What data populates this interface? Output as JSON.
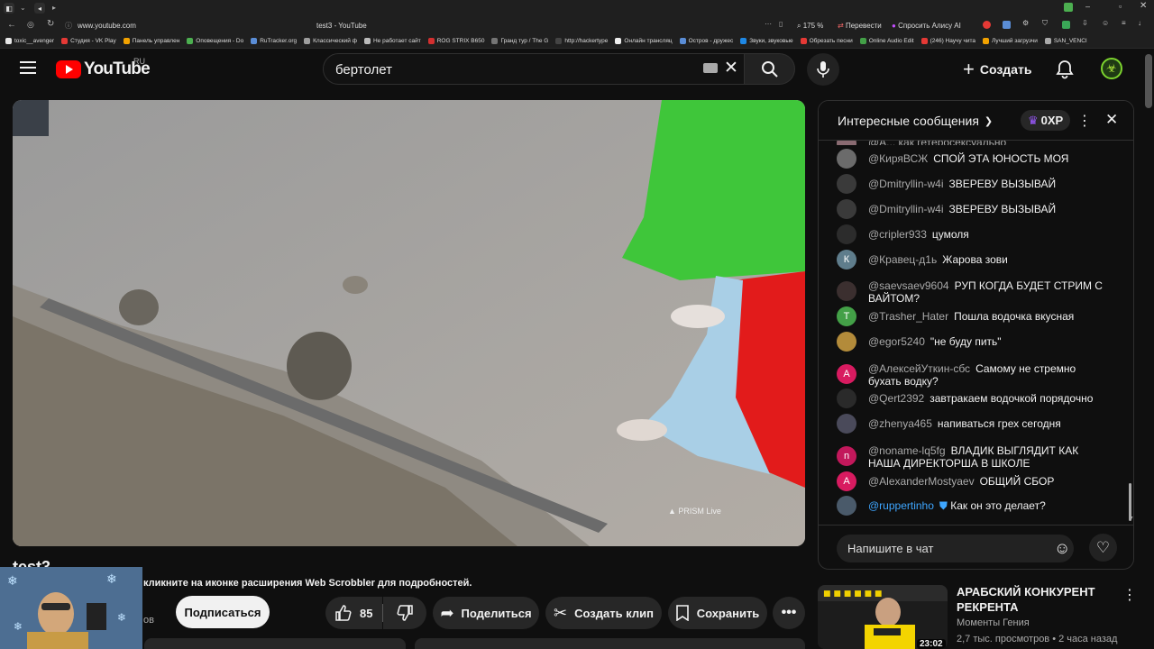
{
  "browser": {
    "url": "www.youtube.com",
    "tab_title": "test3 - YouTube",
    "zoom": "175 %",
    "translate": "Перевести",
    "ask_alice": "Спросить Алису AI",
    "bookmarks": [
      "toxic__avenger",
      "Студия - VK Play",
      "Панель управлен",
      "Оповещения - Do",
      "RuTracker.org",
      "Классический ф",
      "Не работает сайт",
      "ROG STRIX B650",
      "Гранд тур / The G",
      "http://hackertype",
      "Онлайн трансляц",
      "Остров - дружес",
      "Звуки, звуковые",
      "Обрезать песни",
      "Online Audio Edit",
      "(246) Научу чита",
      "Лучший загрузчи",
      "SAN_VENCI"
    ]
  },
  "header": {
    "logo_text": "YouTube",
    "region": "RU",
    "search_value": "бертолет",
    "create_label": "Создать"
  },
  "video": {
    "watermark": "PRISM Live"
  },
  "below": {
    "title": "test3",
    "notice": "кликните на иконке расширения Web Scrobbler для подробностей.",
    "channel_fragment": "ов",
    "subscribe": "Подписаться",
    "likes": "85",
    "share": "Поделиться",
    "clip": "Создать клип",
    "save": "Сохранить"
  },
  "chat": {
    "header_title": "Интересные сообщения",
    "xp": "0XP",
    "input_placeholder": "Напишите в чат",
    "partial_top": "@А... как гетеросексуально",
    "messages": [
      {
        "author": "@КиряВСЖ",
        "text": "СПОЙ ЭТА ЮНОСТЬ МОЯ",
        "initial": "",
        "color": "#6b6b6b"
      },
      {
        "author": "@Dmitryllin-w4i",
        "text": "ЗВЕРЕВУ ВЫЗЫВАЙ",
        "initial": "",
        "color": "#3a3a3a"
      },
      {
        "author": "@Dmitryllin-w4i",
        "text": "ЗВЕРЕВУ ВЫЗЫВАЙ",
        "initial": "",
        "color": "#3a3a3a"
      },
      {
        "author": "@cripler933",
        "text": "цумоля",
        "initial": "",
        "color": "#2c2c2c"
      },
      {
        "author": "@Кравец-д1ь",
        "text": "Жарова зови",
        "initial": "К",
        "color": "#5f7d8c"
      },
      {
        "author": "@saevsaev9604",
        "text": "РУП КОГДА БУДЕТ СТРИМ С ВАЙТОМ?",
        "initial": "",
        "color": "#3b2f2f"
      },
      {
        "author": "@Trasher_Hater",
        "text": "Пошла водочка вкусная",
        "initial": "T",
        "color": "#43a047"
      },
      {
        "author": "@egor5240",
        "text": "\"не буду пить\"",
        "initial": "",
        "color": "#b38b3a"
      },
      {
        "author": "@АлексейУткин-сбс",
        "text": "Самому не стремно бухать водку?",
        "initial": "А",
        "color": "#d81b60"
      },
      {
        "author": "@Qert2392",
        "text": "завтракаем водочкой порядочно",
        "initial": "",
        "color": "#2a2a2a"
      },
      {
        "author": "@zhenya465",
        "text": "напиваться грех сегодня",
        "initial": "",
        "color": "#4a4a5a"
      },
      {
        "author": "@noname-lq5fg",
        "text": "ВЛАДИК ВЫГЛЯДИТ КАК НАША ДИРЕКТОРША В ШКОЛЕ",
        "initial": "n",
        "color": "#c2185b"
      },
      {
        "author": "@AlexanderMostyaev",
        "text": "ОБЩИЙ СБОР",
        "initial": "А",
        "color": "#d81b60"
      },
      {
        "author": "@ruppertinho",
        "text": "Как он это делает?",
        "initial": "",
        "color": "#4a5a6a",
        "verified": true
      }
    ]
  },
  "recommendation": {
    "title": "АРАБСКИЙ КОНКУРЕНТ РЕКРЕНТА",
    "channel": "Моменты Гения",
    "meta": "2,7 тыс. просмотров • 2 часа назад",
    "duration": "23:02"
  }
}
